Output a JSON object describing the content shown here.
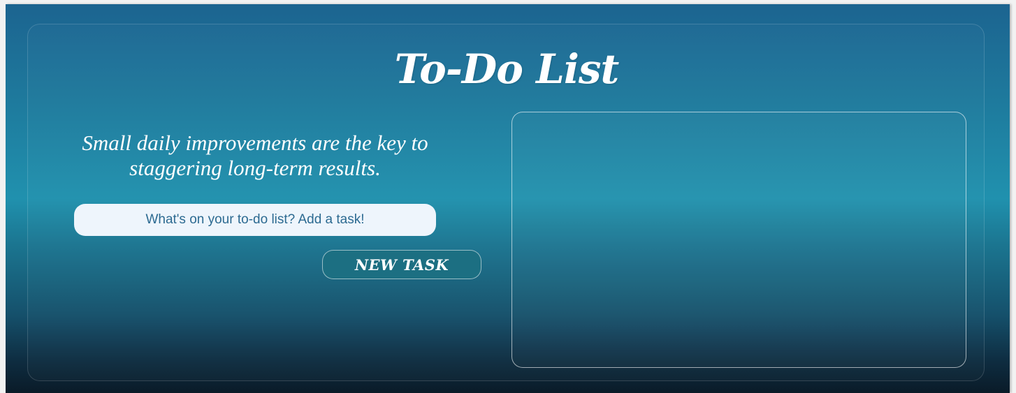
{
  "app": {
    "title": "To-Do List",
    "quote": "Small daily improvements are the key to staggering long-term results."
  },
  "task_input": {
    "value": "",
    "placeholder": "What's on your to-do list? Add a task!"
  },
  "new_task_button": {
    "label": "NEW TASK"
  },
  "task_list": {
    "items": []
  },
  "colors": {
    "background_top": "#1c6490",
    "background_mid": "#2091ae",
    "background_bottom": "#0a1b28",
    "input_background": "#eef5fc",
    "input_text": "#2c6a91",
    "button_background": "#1c6f82",
    "text": "#ffffff"
  }
}
